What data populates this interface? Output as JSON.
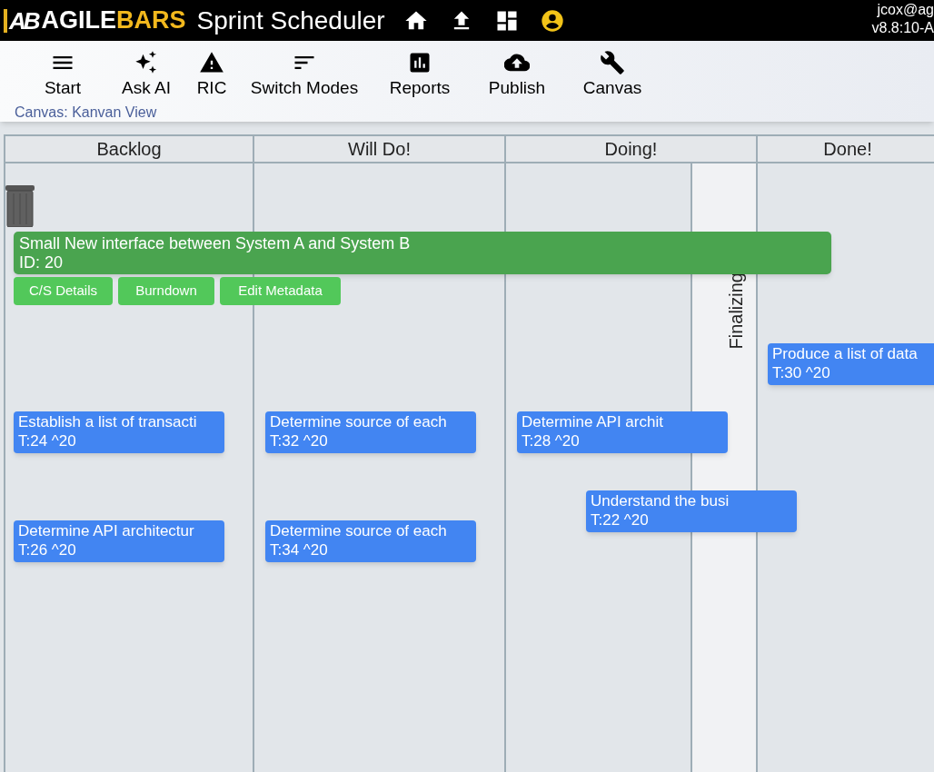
{
  "header": {
    "logo_mark": "AB",
    "logo_part_1": "AGILE",
    "logo_part_2": "BARS",
    "title": "Sprint Scheduler",
    "user": "jcox@ag",
    "version": "v8.8:10-A"
  },
  "toolbar": {
    "items": [
      {
        "label": "Start",
        "kind": "menu"
      },
      {
        "label": "Ask AI",
        "kind": "sparkle"
      },
      {
        "label": "RIC",
        "kind": "warning"
      },
      {
        "label": "Switch Modes",
        "kind": "sort"
      },
      {
        "label": "Reports",
        "kind": "chart"
      },
      {
        "label": "Publish",
        "kind": "upload"
      },
      {
        "label": "Canvas",
        "kind": "wrench"
      }
    ],
    "subtitle": "Canvas: Kanvan View"
  },
  "board": {
    "columns": [
      {
        "title": "Backlog",
        "cards": [
          {
            "title": "Establish a list of transacti",
            "tag": "T:24 ^20"
          },
          {
            "title": "Determine API architectur",
            "tag": "T:26 ^20"
          }
        ]
      },
      {
        "title": "Will Do!",
        "cards": [
          {
            "title": "Determine source of each",
            "tag": "T:32 ^20"
          },
          {
            "title": "Determine source of each",
            "tag": "T:34 ^20"
          }
        ]
      },
      {
        "title": "Doing!",
        "sublane": "Finalizing",
        "cards": [
          {
            "title": "Determine API archit",
            "tag": "T:28 ^20"
          },
          {
            "title": "Understand the busi",
            "tag": "T:22 ^20"
          }
        ]
      },
      {
        "title": "Done!",
        "cards": [
          {
            "title": "Produce a list of data",
            "tag": "T:30 ^20"
          }
        ]
      }
    ],
    "feature": {
      "title": "Small New interface between System A and System B",
      "id": "ID: 20",
      "buttons": [
        "C/S Details",
        "Burndown",
        "Edit Metadata"
      ]
    }
  }
}
